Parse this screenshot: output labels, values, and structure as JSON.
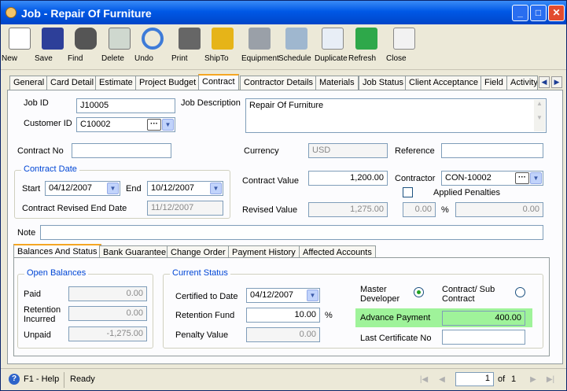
{
  "window": {
    "title": "Job - Repair Of Furniture"
  },
  "toolbar": [
    "New",
    "Save",
    "Find",
    "Delete",
    "Undo",
    "Print",
    "ShipTo",
    "Equipment",
    "Schedule",
    "Duplicate",
    "Refresh",
    "Close"
  ],
  "tabs": [
    "General",
    "Card Detail",
    "Estimate",
    "Project Budget",
    "Contract",
    "Contractor Details",
    "Materials",
    "Job Status",
    "Client Acceptance",
    "Field",
    "Activity"
  ],
  "header": {
    "job_id_label": "Job ID",
    "job_id": "J10005",
    "customer_id_label": "Customer ID",
    "customer_id": "C10002",
    "job_description_label": "Job Description",
    "job_description": "Repair Of Furniture"
  },
  "contract": {
    "contract_no_label": "Contract No",
    "contract_no": "",
    "currency_label": "Currency",
    "currency": "USD",
    "reference_label": "Reference",
    "reference": "",
    "contract_date_title": "Contract Date",
    "start_label": "Start",
    "start": "04/12/2007",
    "end_label": "End",
    "end": "10/12/2007",
    "revised_end_label": "Contract Revised End Date",
    "revised_end": "11/12/2007",
    "contract_value_label": "Contract Value",
    "contract_value": "1,200.00",
    "contractor_label": "Contractor",
    "contractor": "CON-10002",
    "applied_penalties_label": "Applied Penalties",
    "revised_value_label": "Revised Value",
    "revised_value": "1,275.00",
    "penalty_amount": "0.00",
    "percent_sign": "%",
    "penalty_percent": "0.00",
    "note_label": "Note",
    "note": ""
  },
  "subtabs": [
    "Balances And Status",
    "Bank Guarantee",
    "Change Order",
    "Payment History",
    "Affected Accounts"
  ],
  "balances": {
    "title": "Open Balances",
    "paid_label": "Paid",
    "paid": "0.00",
    "retention_label": "Retention Incurred",
    "retention": "0.00",
    "unpaid_label": "Unpaid",
    "unpaid": "-1,275.00"
  },
  "status": {
    "title": "Current Status",
    "certified_label": "Certified to Date",
    "certified": "04/12/2007",
    "retention_fund_label": "Retention Fund",
    "retention_fund": "10.00",
    "percent_sign": "%",
    "penalty_value_label": "Penalty Value",
    "penalty_value": "0.00",
    "master_label": "Master Developer",
    "subcontract_label": "Contract/ Sub Contract",
    "advance_label": "Advance Payment",
    "advance": "400.00",
    "last_cert_label": "Last Certificate No",
    "last_cert": "",
    "highlight_color": "#9ff39a"
  },
  "statusbar": {
    "help": "F1 - Help",
    "ready": "Ready",
    "page": "1",
    "of": "of",
    "total": "1"
  }
}
